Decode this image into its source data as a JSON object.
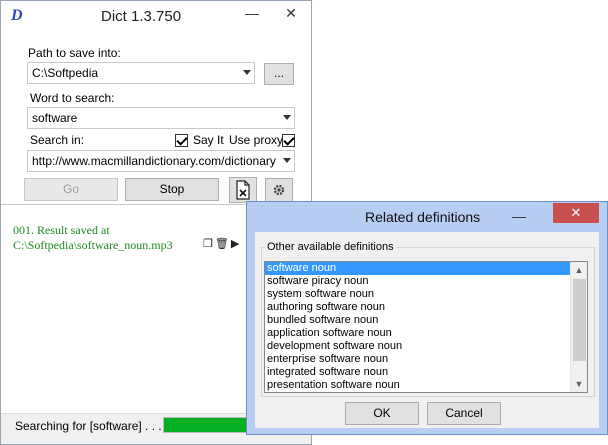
{
  "main_window": {
    "title": "Dict 1.3.750",
    "logo": "D",
    "minimize_glyph": "—",
    "close_glyph": "✕",
    "path_label": "Path to save into:",
    "path_value": "C:\\Softpedia",
    "browse_label": "...",
    "word_label": "Word to search:",
    "word_value": "software",
    "search_in_label": "Search in:",
    "say_it_label": "Say It",
    "use_proxy_label": "Use proxy",
    "say_it_checked": true,
    "use_proxy_checked": true,
    "source_url": "http://www.macmillandictionary.com/dictionary/british/",
    "go_label": "Go",
    "stop_label": "Stop",
    "log": {
      "line1": "001. Result saved at",
      "line2": "C:\\Softpedia\\software_noun.mp3"
    },
    "status_text": "Searching for [software] . . .",
    "progress": 1.0
  },
  "dialog": {
    "title": "Related definitions",
    "minimize_glyph": "—",
    "close_glyph": "✕",
    "group_label": "Other available definitions",
    "items": [
      "software  noun",
      "software piracy  noun",
      "system software  noun",
      "authoring software  noun",
      "bundled software  noun",
      "application software  noun",
      "development software  noun",
      "enterprise software  noun",
      "integrated software  noun",
      "presentation software  noun"
    ],
    "selected_index": 0,
    "ok_label": "OK",
    "cancel_label": "Cancel"
  },
  "colors": {
    "log_text": "#1e8a1e",
    "progress_fill": "#06b025",
    "selection": "#3399ff",
    "dialog_frame": "#b7cdf2",
    "close_button": "#c7504f"
  }
}
